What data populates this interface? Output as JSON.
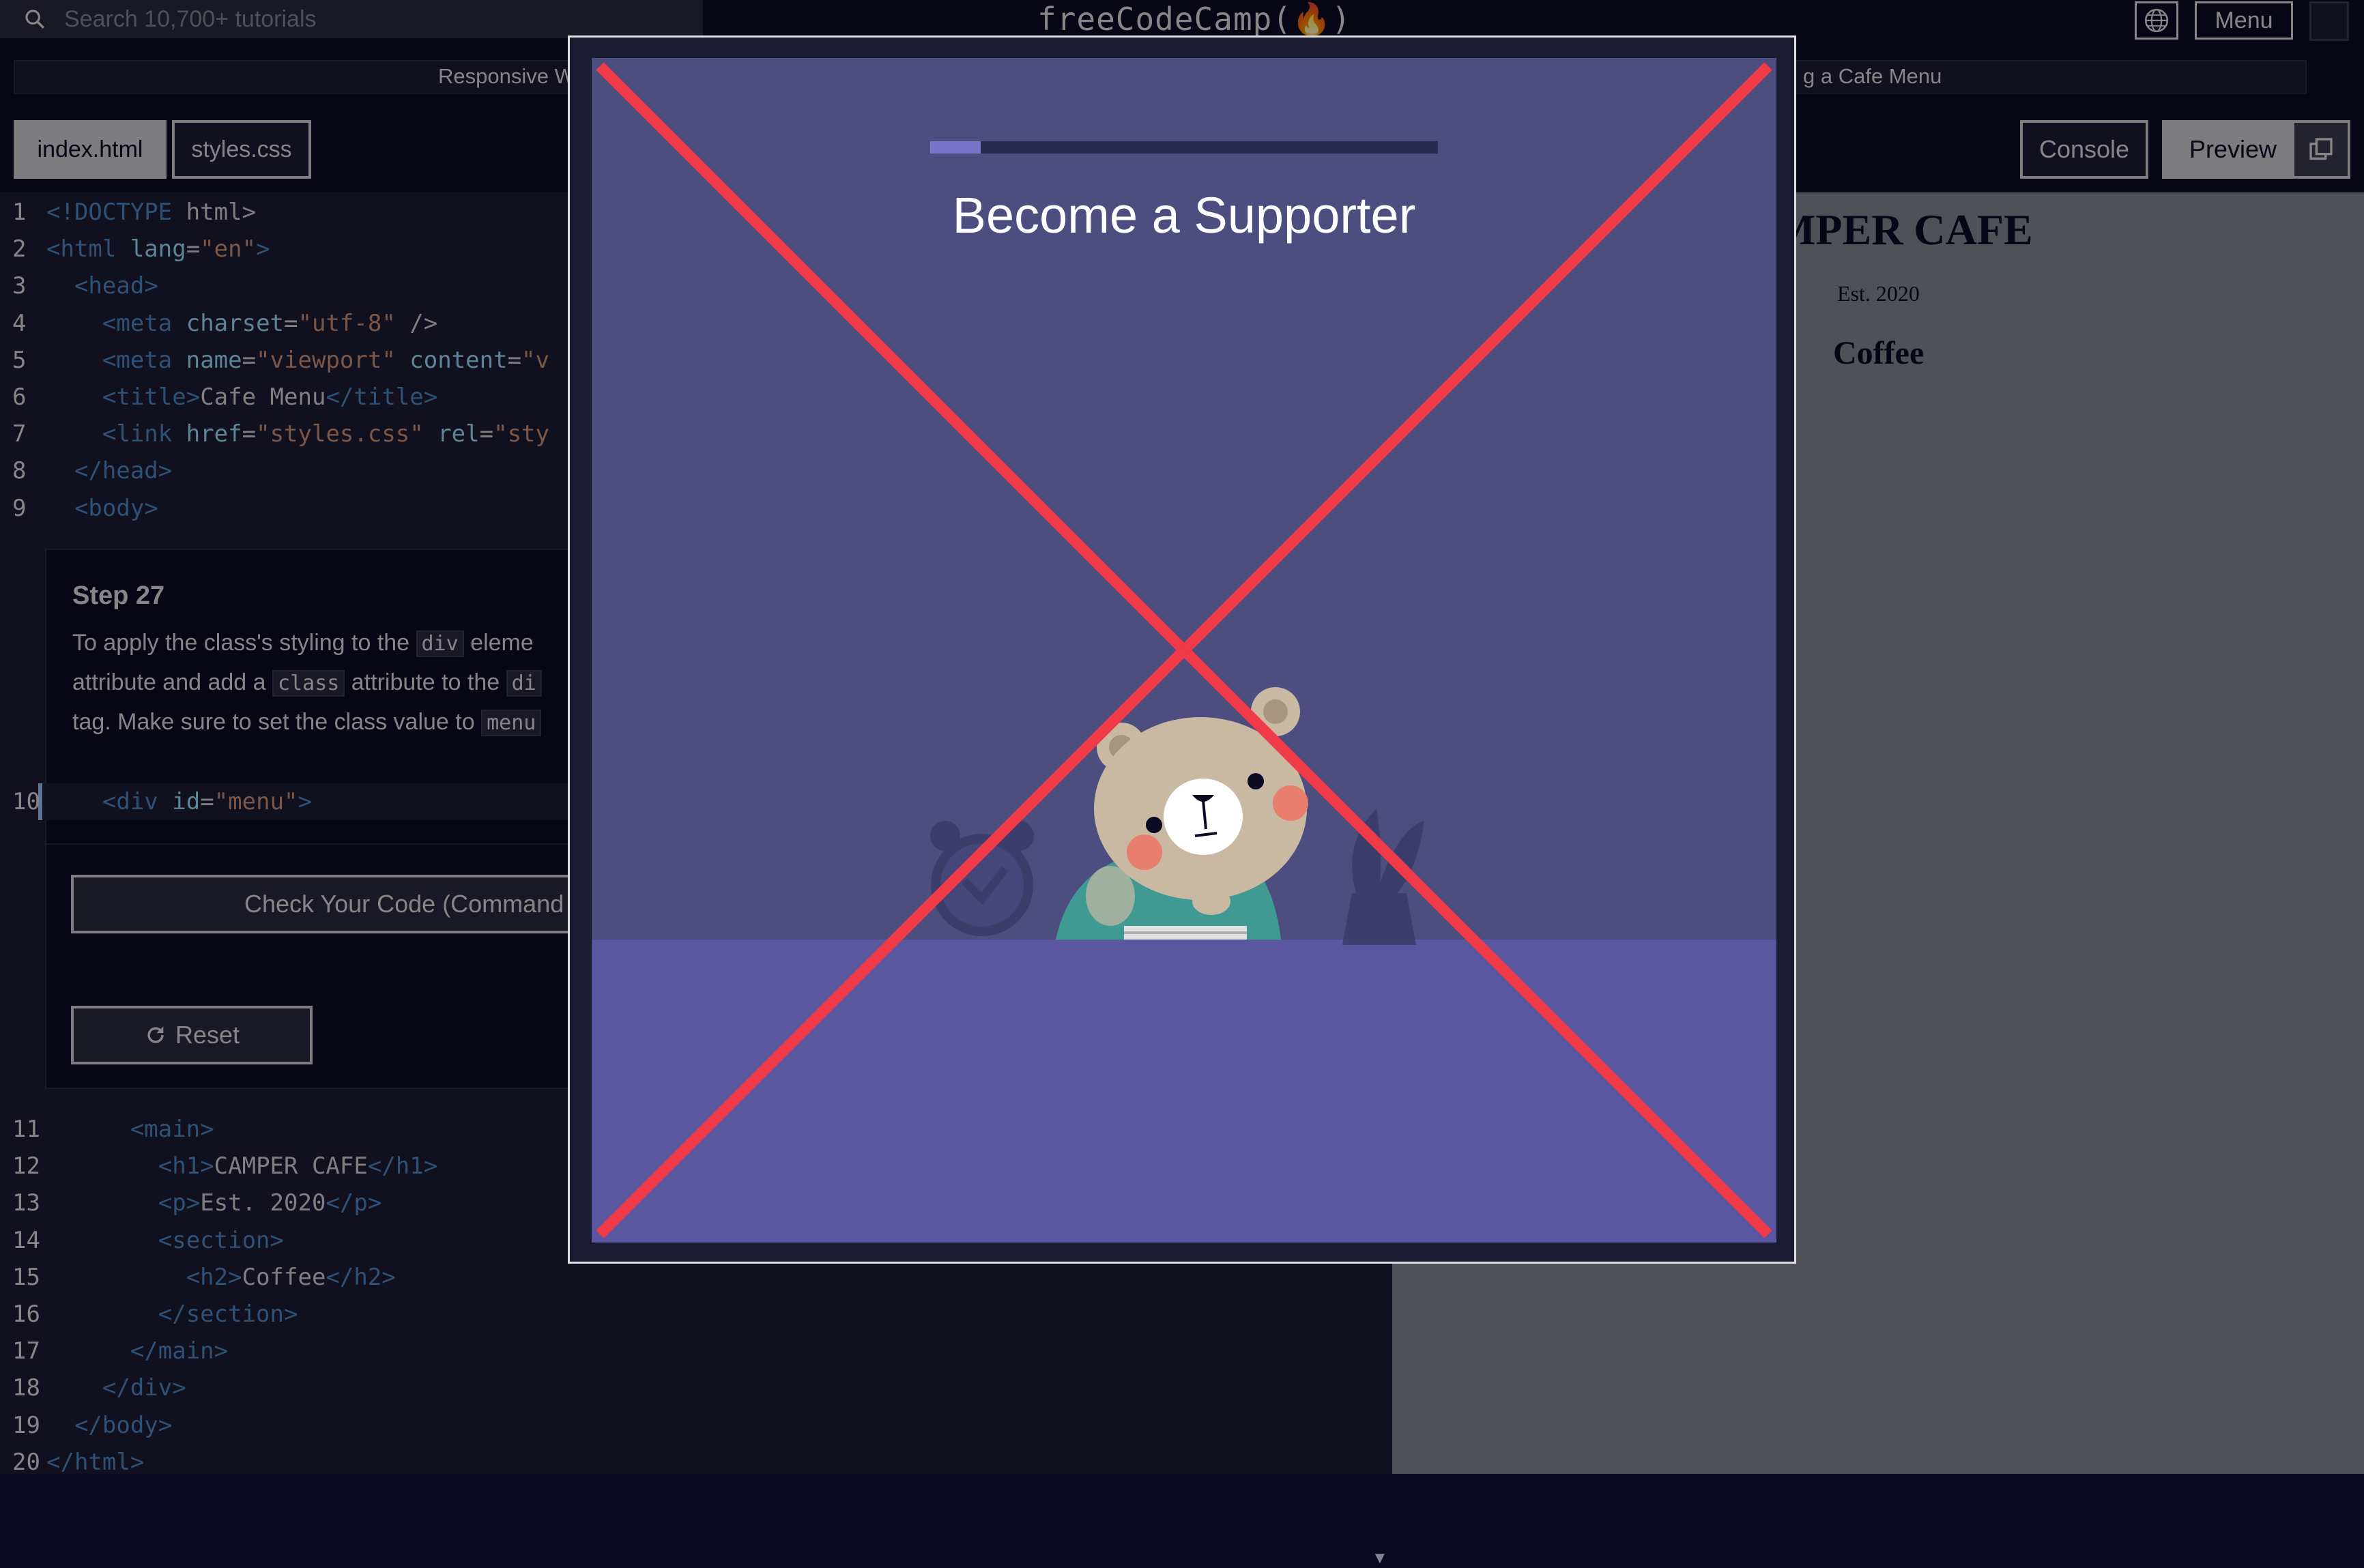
{
  "search": {
    "placeholder": "Search 10,700+ tutorials"
  },
  "brand": {
    "logo_text": "freeCodeCamp(🔥)"
  },
  "nav": {
    "menu_label": "Menu",
    "globe_icon": "globe-icon"
  },
  "breadcrumb": {
    "course": "Responsive W",
    "project": "g a Cafe Menu"
  },
  "editor": {
    "tabs": [
      {
        "label": "index.html",
        "active": true
      },
      {
        "label": "styles.css",
        "active": false
      }
    ],
    "lines_top": [
      {
        "n": "1",
        "code": "<!DOCTYPE html>"
      },
      {
        "n": "2",
        "code": "<html lang=\"en\">"
      },
      {
        "n": "3",
        "code": "  <head>"
      },
      {
        "n": "4",
        "code": "    <meta charset=\"utf-8\" />"
      },
      {
        "n": "5",
        "code": "    <meta name=\"viewport\" content=\"v"
      },
      {
        "n": "6",
        "code": "    <title>Cafe Menu</title>"
      },
      {
        "n": "7",
        "code": "    <link href=\"styles.css\" rel=\"sty"
      },
      {
        "n": "8",
        "code": "  </head>"
      },
      {
        "n": "9",
        "code": "  <body>"
      }
    ],
    "active_line": {
      "n": "10",
      "code": "    <div id=\"menu\">"
    },
    "lines_bottom": [
      {
        "n": "11",
        "code": "      <main>"
      },
      {
        "n": "12",
        "code": "        <h1>CAMPER CAFE</h1>"
      },
      {
        "n": "13",
        "code": "        <p>Est. 2020</p>"
      },
      {
        "n": "14",
        "code": "        <section>"
      },
      {
        "n": "15",
        "code": "          <h2>Coffee</h2>"
      },
      {
        "n": "16",
        "code": "        </section>"
      },
      {
        "n": "17",
        "code": "      </main>"
      },
      {
        "n": "18",
        "code": "    </div>"
      },
      {
        "n": "19",
        "code": "  </body>"
      },
      {
        "n": "20",
        "code": "</html>"
      }
    ]
  },
  "step": {
    "title": "Step 27",
    "desc_1": "To apply the class's styling to the ",
    "code_1": "div",
    "desc_2": " eleme",
    "desc_3": "attribute and add a ",
    "code_2": "class",
    "desc_4": " attribute to the ",
    "code_3": "di",
    "desc_5": "tag. Make sure to set the class value to ",
    "code_4": "menu"
  },
  "actions": {
    "check_label": "Check Your Code (Command",
    "reset_label": "Reset"
  },
  "preview": {
    "console_label": "Console",
    "preview_label": "Preview",
    "h1": "MPER CAFE",
    "p": "Est. 2020",
    "h2": "Coffee"
  },
  "modal": {
    "title": "Become a Supporter",
    "progress_percent": 10
  },
  "colors": {
    "accent": "#99c9ff",
    "close_x": "#f03a47",
    "modal_bg": "#4d4d80",
    "modal_floor": "#5a57a0"
  }
}
